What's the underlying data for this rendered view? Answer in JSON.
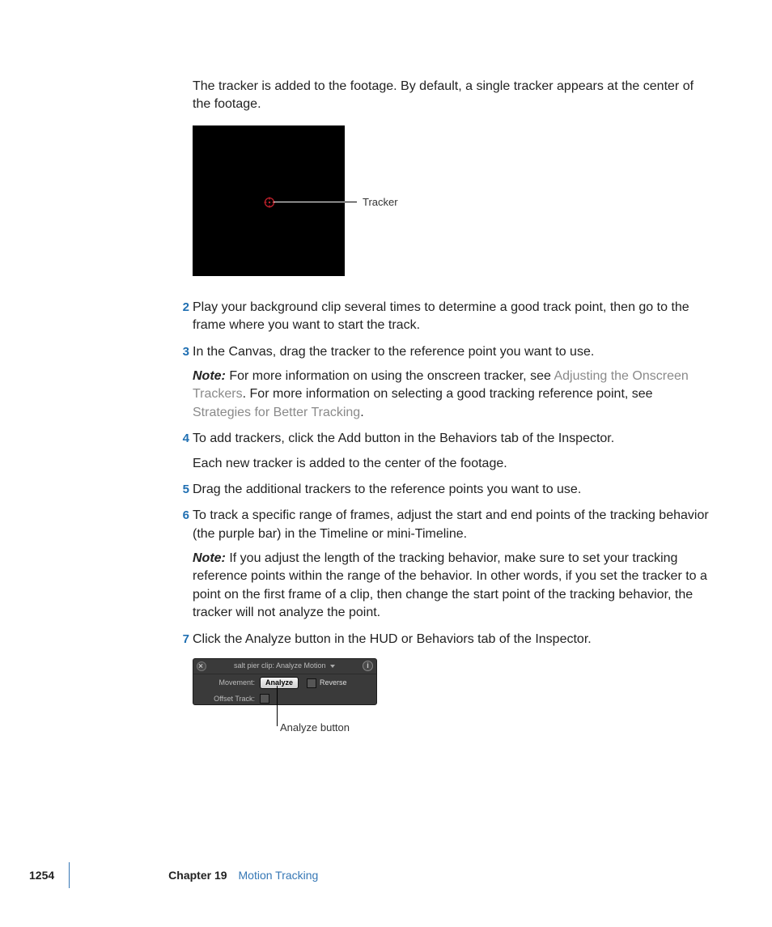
{
  "intro": "The tracker is added to the footage. By default, a single tracker appears at the center of the footage.",
  "figure1": {
    "callout": "Tracker"
  },
  "steps": {
    "2": {
      "num": "2",
      "text": "Play your background clip several times to determine a good track point, then go to the frame where you want to start the track."
    },
    "3": {
      "num": "3",
      "text": "In the Canvas, drag the tracker to the reference point you want to use.",
      "note_label": "Note:",
      "note_a": "  For more information on using the onscreen tracker, see ",
      "link_a": "Adjusting the Onscreen Trackers",
      "note_b": ". For more information on selecting a good tracking reference point, see ",
      "link_b": "Strategies for Better Tracking",
      "note_c": "."
    },
    "4": {
      "num": "4",
      "text": "To add trackers, click the Add button in the Behaviors tab of the Inspector.",
      "follow": "Each new tracker is added to the center of the footage."
    },
    "5": {
      "num": "5",
      "text": "Drag the additional trackers to the reference points you want to use."
    },
    "6": {
      "num": "6",
      "text": "To track a specific range of frames, adjust the start and end points of the tracking behavior (the purple bar) in the Timeline or mini-Timeline.",
      "note_label": "Note:",
      "note_text": "  If you adjust the length of the tracking behavior, make sure to set your tracking reference points within the range of the behavior. In other words, if you set the tracker to a point on the first frame of a clip, then change the start point of the tracking behavior, the tracker will not analyze the point."
    },
    "7": {
      "num": "7",
      "text": "Click the Analyze button in the HUD or Behaviors tab of the Inspector."
    }
  },
  "hud": {
    "title": "salt pier clip: Analyze Motion",
    "row_movement": "Movement:",
    "analyze": "Analyze",
    "reverse": "Reverse",
    "row_offset": "Offset Track:",
    "info_glyph": "i"
  },
  "figure2": {
    "callout": "Analyze button"
  },
  "footer": {
    "page": "1254",
    "chapter_label": "Chapter 19",
    "chapter_title": "Motion Tracking"
  }
}
